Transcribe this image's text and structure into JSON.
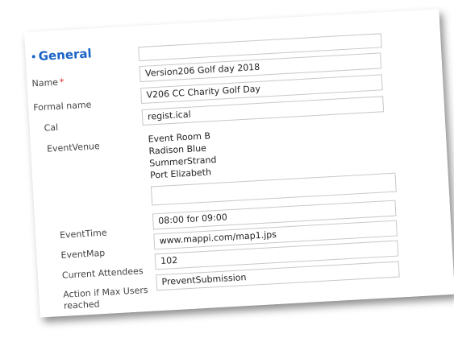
{
  "section": {
    "title": "General"
  },
  "fields": {
    "name": {
      "label": "Name",
      "required_mark": "*",
      "value": "Version206 Golf day 2018"
    },
    "formal_name": {
      "label": "Formal name",
      "value": "V206 CC Charity Golf Day"
    },
    "cal": {
      "label": "Cal",
      "value": "regist.ical"
    },
    "event_venue": {
      "label": "EventVenue",
      "lines": [
        "Event Room B",
        "Radison Blue",
        "SummerStrand",
        "Port Elizabeth"
      ]
    },
    "event_time": {
      "label": "EventTime",
      "value": "08:00 for 09:00"
    },
    "event_map": {
      "label": "EventMap",
      "value": "www.mappi.com/map1.jps"
    },
    "current_attendees": {
      "label": "Current Attendees",
      "value": "102"
    },
    "action_max_users": {
      "label_line1": "Action if Max Users",
      "label_line2": "reached",
      "value": "PreventSubmission"
    }
  },
  "colors": {
    "accent": "#1b63c6",
    "required": "#e02020"
  }
}
